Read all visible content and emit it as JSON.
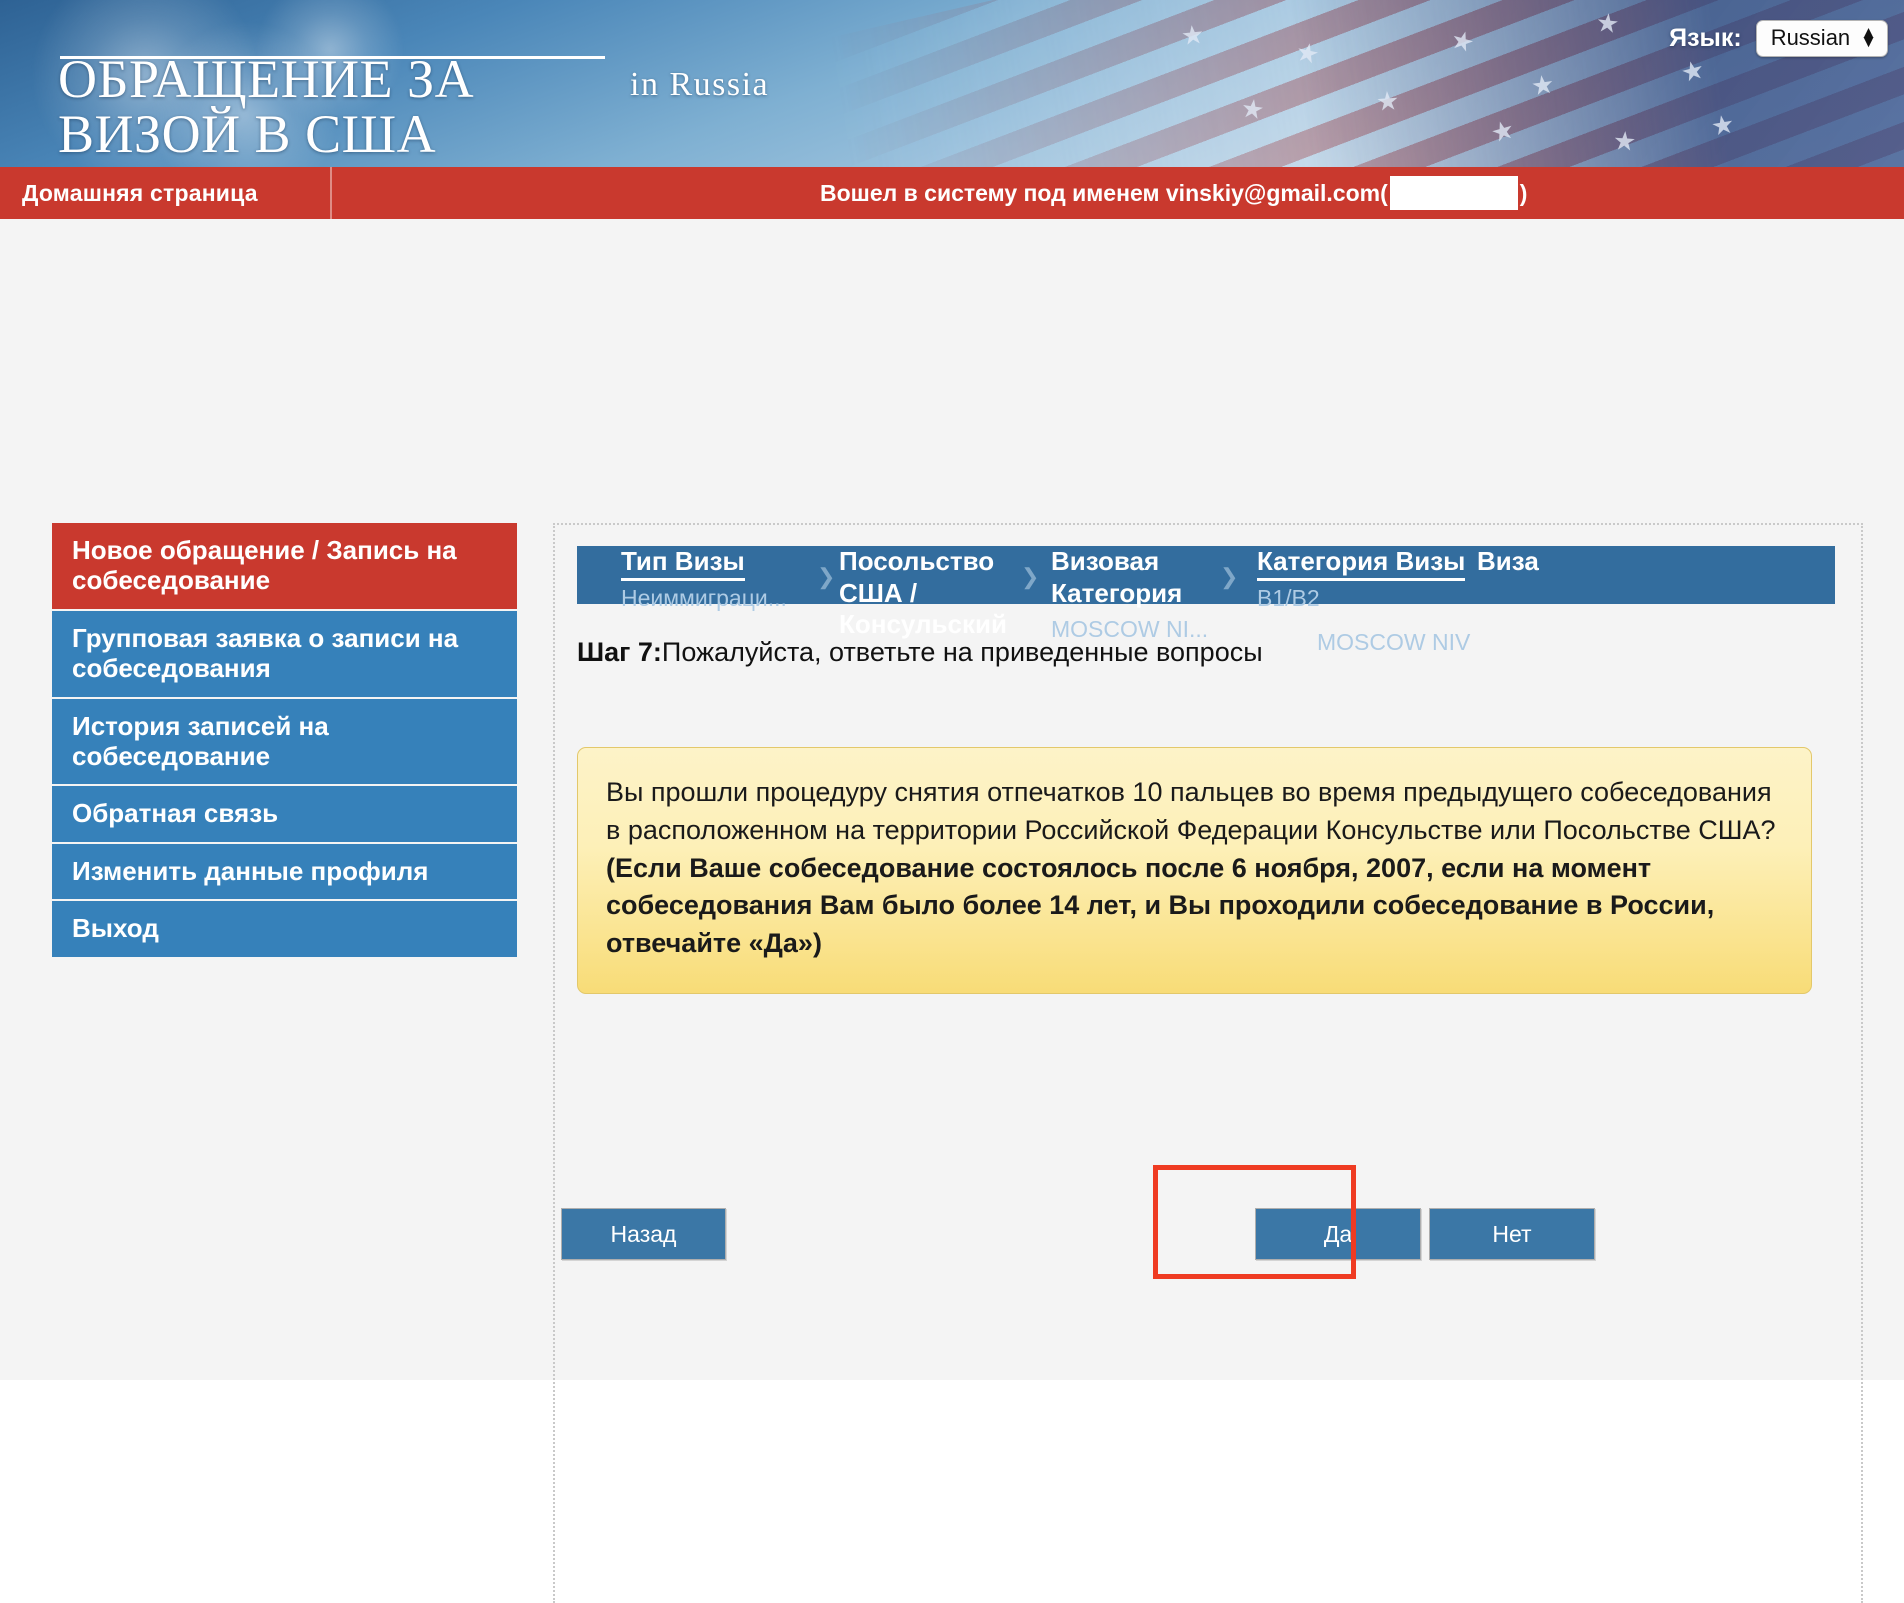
{
  "header": {
    "title_line1": "ОБРАЩЕНИЕ ЗА",
    "title_line2": "ВИЗОЙ В США",
    "subtitle": "in  Russia",
    "language_label": "Язык:",
    "language_value": "Russian",
    "spin_up": "▲",
    "spin_down": "▼"
  },
  "navbar": {
    "home_label": "Домашняя страница",
    "login_prefix": "Вошел в систему под именем",
    "login_email": "vinskiy@gmail.com",
    "login_paren_open": "(",
    "login_paren_close": ")"
  },
  "sidebar": {
    "items": [
      {
        "label": "Новое обращение / Запись на собеседование",
        "active": true
      },
      {
        "label": "Групповая заявка о записи на собеседования",
        "active": false
      },
      {
        "label": "История записей на собеседование",
        "active": false
      },
      {
        "label": "Обратная связь",
        "active": false
      },
      {
        "label": "Изменить данные профиля",
        "active": false
      },
      {
        "label": "Выход",
        "active": false
      }
    ]
  },
  "breadcrumb": {
    "arrow": "❯",
    "steps": [
      {
        "title": "Тип Визы",
        "sub": "Неиммиграци...",
        "underline": true
      },
      {
        "title": "Посольство США / Консульский",
        "sub": "",
        "underline": false
      },
      {
        "title": "Визовая Категория",
        "sub": "MOSCOW NI...",
        "underline": true
      },
      {
        "title": "Категория Визы",
        "sub": "B1/B2",
        "underline": true
      },
      {
        "title": "Виза",
        "sub": "MOSCOW NIV",
        "underline": true
      }
    ]
  },
  "step": {
    "label": "Шаг 7:",
    "text": "Пожалуйста, ответьте на приведенные вопросы"
  },
  "question": {
    "normal_text": "Вы прошли процедуру снятия отпечатков 10 пальцев во время предыдущего собеседования в расположенном на территории Российской Федерации Консульстве или Посольстве США? ",
    "bold_text": "(Если Ваше собеседование состоялось после 6 ноября, 2007,  если на момент собеседования Вам было более 14 лет, и Вы проходили собеседование в России, отвечайте «Да»)"
  },
  "buttons": {
    "back": "Назад",
    "yes": "Да",
    "no": "Нет"
  },
  "colors": {
    "red_nav": "#c9392e",
    "blue_menu": "#3681ba",
    "blue_crumb": "#336d9e",
    "button_blue": "#3b77a6",
    "highlight": "#ef3b22",
    "callout_yellow": "#f8dc77"
  }
}
